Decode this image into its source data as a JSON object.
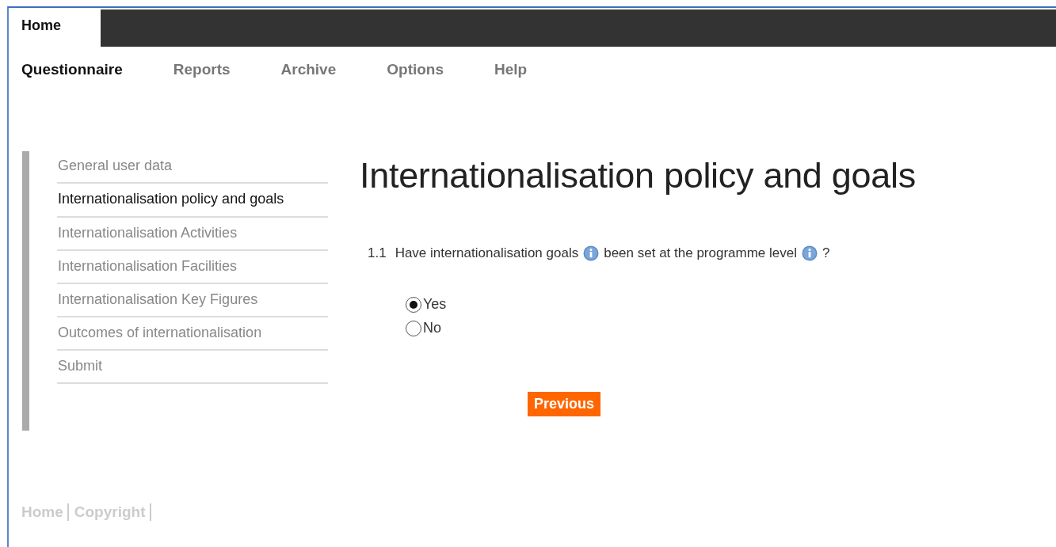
{
  "top_tabs": [
    {
      "label": "Home",
      "selected": true
    }
  ],
  "menu": [
    {
      "label": "Questionnaire",
      "selected": true
    },
    {
      "label": "Reports",
      "selected": false
    },
    {
      "label": "Archive",
      "selected": false
    },
    {
      "label": "Options",
      "selected": false
    },
    {
      "label": "Help",
      "selected": false
    }
  ],
  "sidebar": {
    "items": [
      {
        "label": "General user data",
        "selected": false
      },
      {
        "label": "Internationalisation policy and goals",
        "selected": true
      },
      {
        "label": "Internationalisation Activities",
        "selected": false
      },
      {
        "label": "Internationalisation Facilities",
        "selected": false
      },
      {
        "label": "Internationalisation Key Figures",
        "selected": false
      },
      {
        "label": "Outcomes of internationalisation",
        "selected": false
      },
      {
        "label": "Submit",
        "selected": false
      }
    ]
  },
  "page_title": "Internationalisation policy and goals",
  "question": {
    "number": "1.1",
    "segments": [
      {
        "kind": "text",
        "text": "Have internationalisation goals"
      },
      {
        "kind": "info"
      },
      {
        "kind": "text",
        "text": "been set at the programme level"
      },
      {
        "kind": "info"
      },
      {
        "kind": "text",
        "text": "?"
      }
    ],
    "options": [
      {
        "label": "Yes",
        "selected": true
      },
      {
        "label": "No",
        "selected": false
      }
    ]
  },
  "buttons": [
    {
      "label": "Previous"
    }
  ],
  "footer_links": [
    "Home",
    "Copyright"
  ]
}
